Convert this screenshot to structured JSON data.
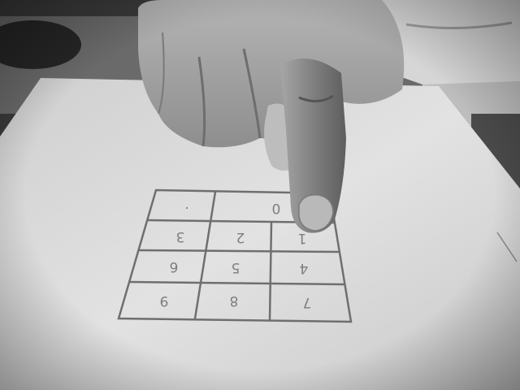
{
  "keypad": {
    "cells": [
      {
        "id": "r1c1",
        "label": "."
      },
      {
        "id": "r1c2",
        "label": "0"
      },
      {
        "id": "r2c1",
        "label": "3"
      },
      {
        "id": "r2c2",
        "label": "2"
      },
      {
        "id": "r2c3",
        "label": "1"
      },
      {
        "id": "r3c1",
        "label": "6"
      },
      {
        "id": "r3c2",
        "label": "5"
      },
      {
        "id": "r3c3",
        "label": "4"
      },
      {
        "id": "r4c1",
        "label": "9"
      },
      {
        "id": "r4c2",
        "label": "8"
      },
      {
        "id": "r4c3",
        "label": "7"
      }
    ]
  },
  "colors": {
    "paper": "#dcdcdc",
    "grid_ink": "#6f6f6f",
    "skin": "#9a9a9a",
    "background": "#2c2c2c"
  }
}
